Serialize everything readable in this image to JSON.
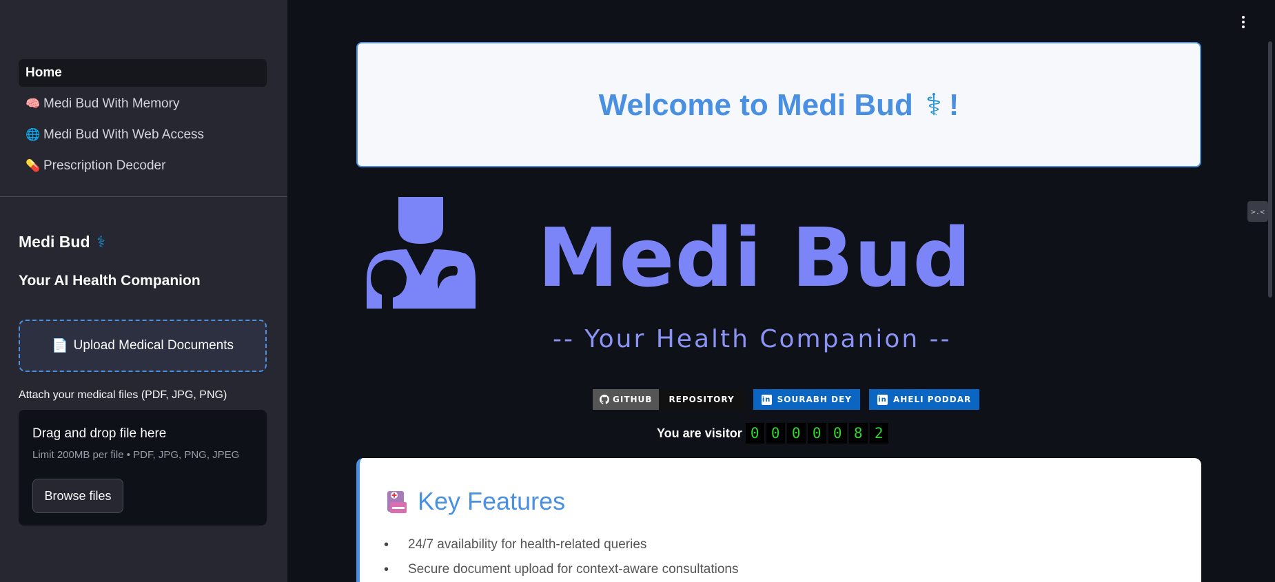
{
  "sidebar": {
    "nav": [
      {
        "label": "Home",
        "emoji": "",
        "active": true
      },
      {
        "label": "Medi Bud With Memory",
        "emoji": "🧠",
        "active": false
      },
      {
        "label": "Medi Bud With Web Access",
        "emoji": "🌐",
        "active": false
      },
      {
        "label": "Prescription Decoder",
        "emoji": "💊",
        "active": false
      }
    ],
    "title": "Medi Bud",
    "title_symbol": "⚕",
    "subtitle": "Your AI Health Companion",
    "upload_box_label": "Upload Medical Documents",
    "upload_box_emoji": "📄",
    "attach_label": "Attach your medical files (PDF, JPG, PNG)",
    "dropzone": {
      "title": "Drag and drop file here",
      "limit": "Limit 200MB per file • PDF, JPG, PNG, JPEG",
      "browse_label": "Browse files"
    }
  },
  "main": {
    "welcome": {
      "text": "Welcome to Medi Bud",
      "symbol": "⚕",
      "suffix": "!"
    },
    "logo": {
      "text": "Medi Bud",
      "tagline": "-- Your Health Companion --"
    },
    "badges": {
      "github": {
        "left": "GITHUB",
        "right": "REPOSITORY"
      },
      "linkedin_1": "SOURABH DEY",
      "linkedin_2": "AHELI PODDAR"
    },
    "visitor": {
      "label": "You are visitor",
      "digits": [
        "0",
        "0",
        "0",
        "0",
        "0",
        "8",
        "2"
      ]
    },
    "features": {
      "title": "Key Features",
      "items": [
        "24/7 availability for health-related queries",
        "Secure document upload for context-aware consultations"
      ]
    }
  },
  "icons": {
    "menu": "kebab-menu-icon",
    "github": "github-icon",
    "linkedin": "linkedin-icon"
  },
  "colors": {
    "accent": "#4a90e2",
    "logo": "#7b85f7",
    "counter": "#2ed52e",
    "linkedin": "#0a66c2"
  }
}
